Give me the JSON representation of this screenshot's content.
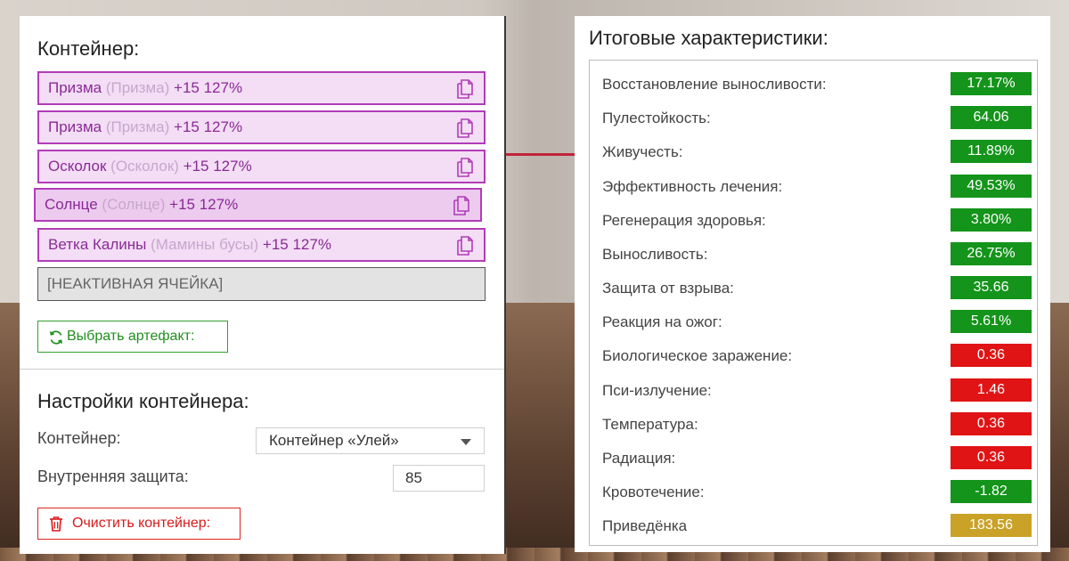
{
  "container": {
    "title": "Контейнер:",
    "slots": [
      {
        "name": "Призма",
        "sub": "(Призма)",
        "pct": "+15 127%"
      },
      {
        "name": "Призма",
        "sub": "(Призма)",
        "pct": "+15 127%"
      },
      {
        "name": "Осколок",
        "sub": "(Осколок)",
        "pct": "+15 127%"
      },
      {
        "name": "Солнце",
        "sub": "(Солнце)",
        "pct": "+15 127%"
      },
      {
        "name": "Ветка Калины",
        "sub": "(Мамины бусы)",
        "pct": "+15 127%"
      }
    ],
    "inactive_label": "[НЕАКТИВНАЯ ЯЧЕЙКА]",
    "choose_button": "Выбрать артефакт:"
  },
  "settings": {
    "title": "Настройки контейнера:",
    "container_label": "Контейнер:",
    "container_value": "Контейнер «Улей»",
    "inner_protection_label": "Внутренняя защита:",
    "inner_protection_value": "85",
    "clear_button": "Очистить контейнер:"
  },
  "totals": {
    "title": "Итоговые характеристики:",
    "stats": [
      {
        "name": "Восстановление выносливости:",
        "value": "17.17%",
        "status": "positive"
      },
      {
        "name": "Пулестойкость:",
        "value": "64.06",
        "status": "positive"
      },
      {
        "name": "Живучесть:",
        "value": "11.89%",
        "status": "positive"
      },
      {
        "name": "Эффективность лечения:",
        "value": "49.53%",
        "status": "positive"
      },
      {
        "name": "Регенерация здоровья:",
        "value": "3.80%",
        "status": "positive"
      },
      {
        "name": "Выносливость:",
        "value": "26.75%",
        "status": "positive"
      },
      {
        "name": "Защита от взрыва:",
        "value": "35.66",
        "status": "positive"
      },
      {
        "name": "Реакция на ожог:",
        "value": "5.61%",
        "status": "positive"
      },
      {
        "name": "Биологическое заражение:",
        "value": "0.36",
        "status": "negative"
      },
      {
        "name": "Пси-излучение:",
        "value": "1.46",
        "status": "negative"
      },
      {
        "name": "Температура:",
        "value": "0.36",
        "status": "negative"
      },
      {
        "name": "Радиация:",
        "value": "0.36",
        "status": "negative"
      },
      {
        "name": "Кровотечение:",
        "value": "-1.82",
        "status": "positive"
      },
      {
        "name": "Приведёнка",
        "value": "183.56",
        "status": "neutral"
      }
    ]
  },
  "colors": {
    "positive": "#14941a",
    "negative": "#e01414",
    "neutral": "#c9a227",
    "slot_border": "#b23cb8",
    "slot_text": "#8a2a95"
  },
  "icons": {
    "slot_action": "copy-icon",
    "choose_button": "refresh-icon",
    "clear_button": "trash-icon",
    "select": "chevron-down-icon"
  }
}
